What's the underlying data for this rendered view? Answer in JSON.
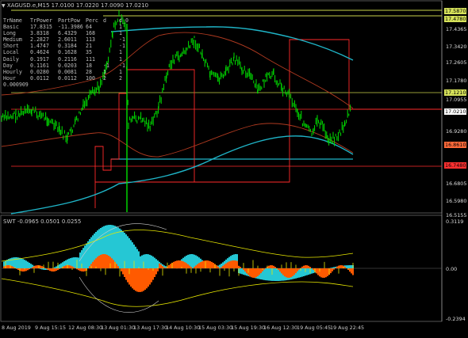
{
  "window": {
    "title": "XAGUSD.e,M15",
    "ohlc": "17.0100 17.0220 17.0090 17.0210"
  },
  "table": {
    "headers": [
      "TrName",
      "TrPower",
      "PartPow",
      "Perc",
      "d",
      "d_0"
    ],
    "rows": [
      [
        "Basic",
        "17.8315",
        "-11.3986",
        "64",
        "",
        "1"
      ],
      [
        "Long",
        "3.8318",
        "6.4329",
        "168",
        "",
        "1"
      ],
      [
        "Medium",
        "2.2827",
        "2.6011",
        "113",
        "",
        "-1"
      ],
      [
        "Short",
        "1.4747",
        "0.3184",
        "21",
        "",
        "-1"
      ],
      [
        "Local",
        "0.4624",
        "0.1628",
        "35",
        "",
        "1"
      ],
      [
        "Daily",
        "0.1917",
        "0.2116",
        "111",
        "",
        "1"
      ],
      [
        "Day",
        "0.1161",
        "0.0203",
        "18",
        "-1",
        "-1"
      ],
      [
        "Hourly",
        "0.0280",
        "0.0081",
        "28",
        "1",
        "1"
      ],
      [
        "Hour",
        "0.0112",
        "0.0112",
        "100",
        "2",
        "2"
      ]
    ],
    "footer": "0.000909"
  },
  "price_axis": {
    "tagged": [
      {
        "label": "17.5870",
        "color": "#d6e25a"
      },
      {
        "label": "17.4780",
        "color": "#d6e25a"
      },
      {
        "label": "17.1210",
        "color": "#d6e25a"
      },
      {
        "label": "17.0210",
        "color": "#ffffff"
      },
      {
        "label": "16.8610",
        "color": "#ff6a3a"
      },
      {
        "label": "16.7480",
        "color": "#ff3030"
      }
    ],
    "plain": [
      "17.4365",
      "17.3420",
      "17.2605",
      "17.1780",
      "17.0955",
      "16.9280",
      "16.6805",
      "16.5980",
      "16.5155"
    ]
  },
  "indicator": {
    "name": "SWT",
    "values": "-0.0965 0.0501 0.0255",
    "axis": [
      "0.3119",
      "0.00",
      "-0.2394"
    ]
  },
  "time_axis": [
    "8 Aug 2019",
    "9 Aug 15:15",
    "12 Aug 08:30",
    "13 Aug 01:30",
    "13 Aug 17:30",
    "14 Aug 10:30",
    "15 Aug 03:30",
    "15 Aug 19:30",
    "16 Aug 12:30",
    "19 Aug 05:45",
    "19 Aug 22:45"
  ],
  "colors": {
    "price": "#00e000",
    "ma_cyan": "#1fb5c8",
    "ma_brown": "#c0392b",
    "level_red": "#ff2a2a",
    "level_yellow": "#c8d24a",
    "hist_cyan": "#25c7d4",
    "hist_orange": "#ff5a00",
    "hist_yellow": "#e6e600"
  }
}
